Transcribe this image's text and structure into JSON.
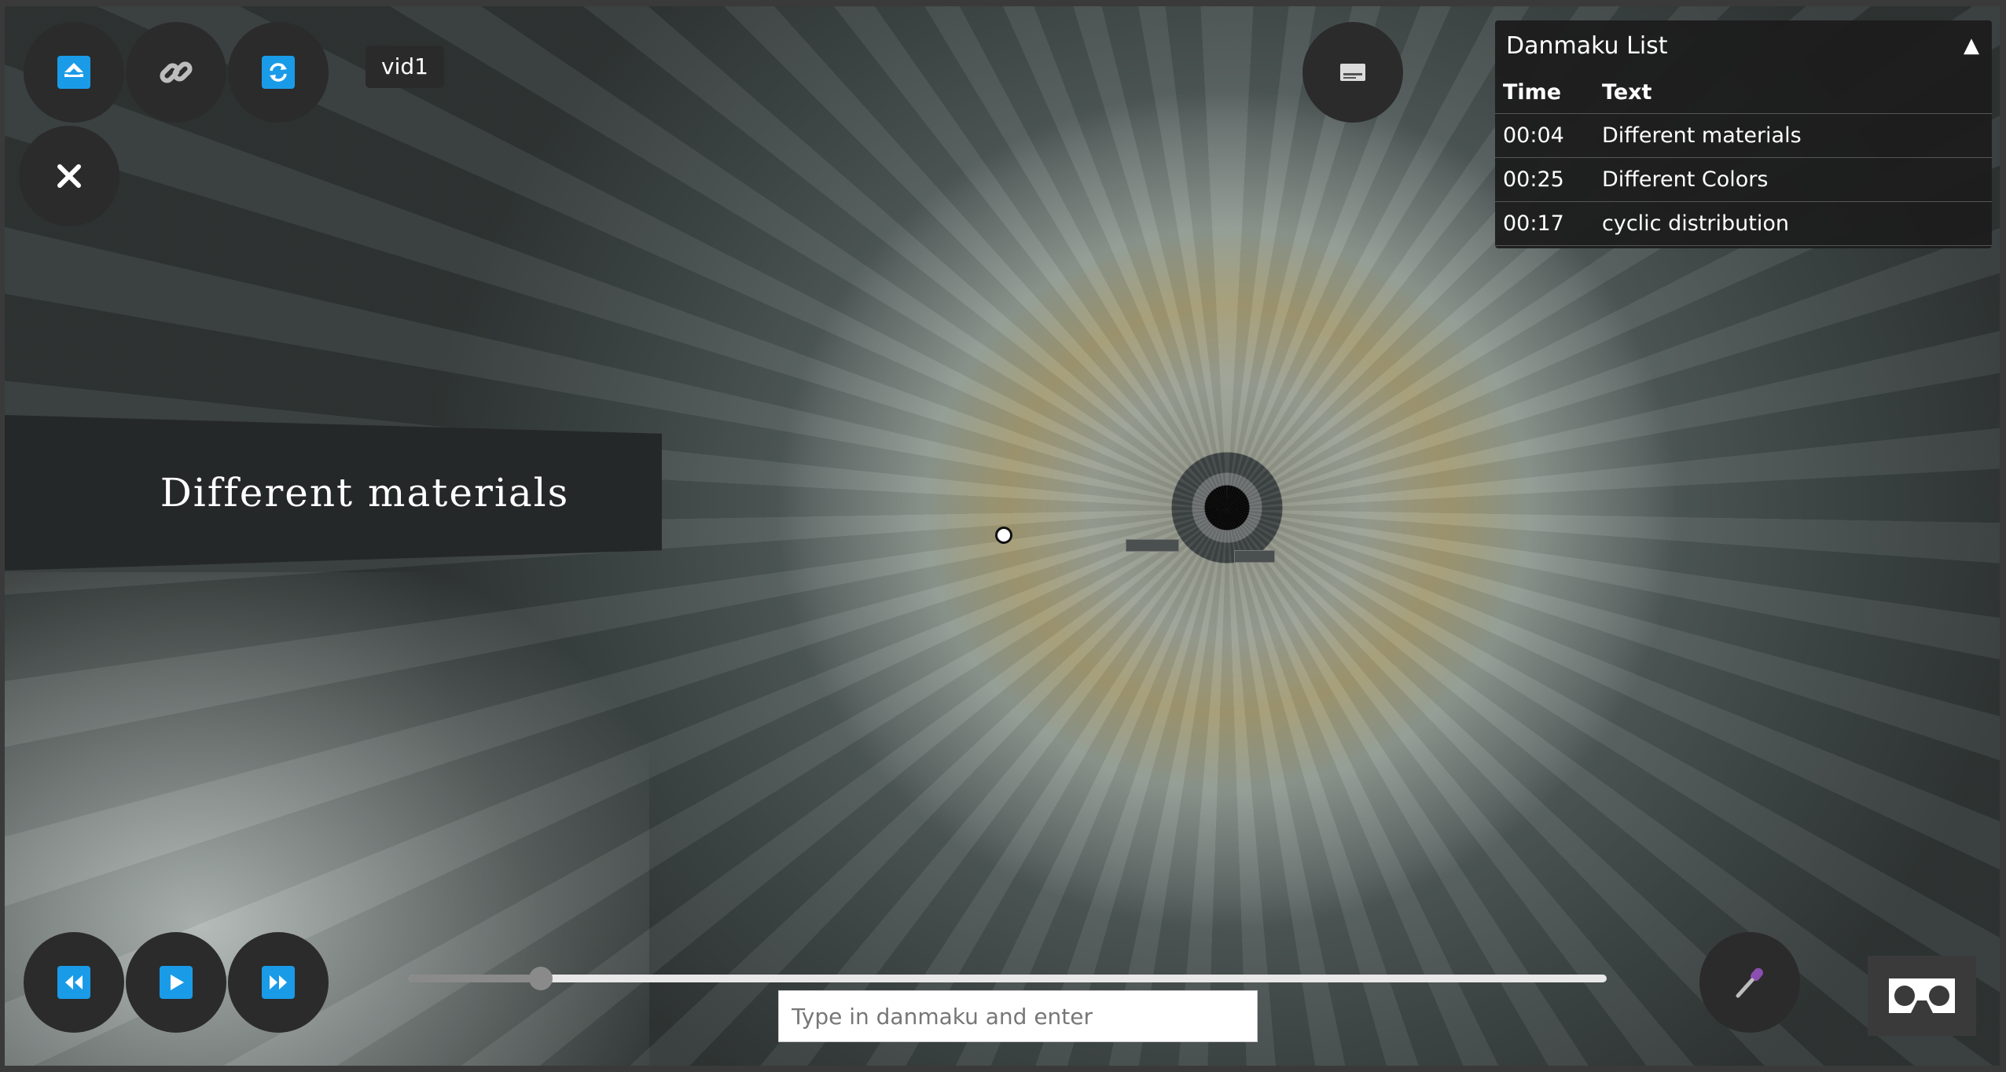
{
  "video": {
    "label": "vid1"
  },
  "banner": {
    "text": "Different materials"
  },
  "danmaku_list": {
    "title": "Danmaku List",
    "toggle": "▲",
    "headers": {
      "time": "Time",
      "text": "Text"
    },
    "rows": [
      {
        "time": "00:04",
        "text": "Different materials"
      },
      {
        "time": "00:25",
        "text": "Different Colors"
      },
      {
        "time": "00:17",
        "text": "cyclic distribution"
      }
    ]
  },
  "seek": {
    "progress": 0.11
  },
  "input": {
    "placeholder": "Type in danmaku and enter"
  },
  "colors": {
    "accent": "#1a9be8",
    "button_bg": "#2b2b2b",
    "panel_bg": "#1c1c1c"
  }
}
